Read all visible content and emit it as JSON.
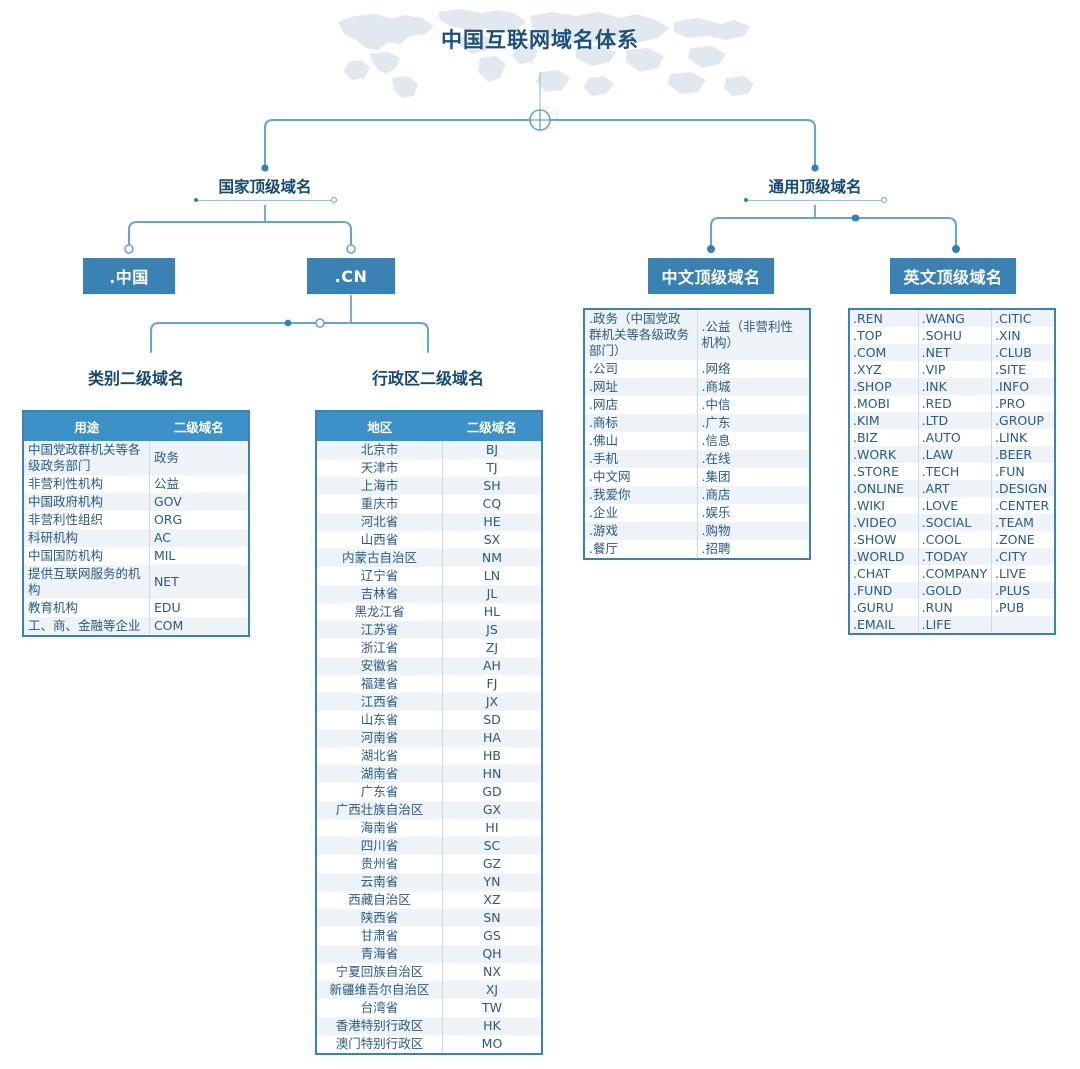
{
  "title": "中国互联网域名体系",
  "nodes": {
    "country_tld": "国家顶级域名",
    "generic_tld": "通用顶级域名"
  },
  "boxes": {
    "cn_chinese": ".中国",
    "cn_ascii": ".CN",
    "chinese_tld": "中文顶级域名",
    "english_tld": "英文顶级域名"
  },
  "captions": {
    "category_sld": "类别二级域名",
    "region_sld": "行政区二级域名"
  },
  "colors": {
    "box_blue": "#3b82b4",
    "header_blue": "#3b91c8",
    "text_dark_blue": "#16496f",
    "cell_text": "#2a5b80",
    "row_stripe": "#eef3f7",
    "border_blue": "#3b82b4",
    "wire_blue": "#4f8fba"
  },
  "category_table": {
    "headers": [
      "用途",
      "二级域名"
    ],
    "rows": [
      [
        "中国党政群机关等各级政务部门",
        "政务"
      ],
      [
        "非营利性机构",
        "公益"
      ],
      [
        "中国政府机构",
        "GOV"
      ],
      [
        "非营利性组织",
        "ORG"
      ],
      [
        "科研机构",
        "AC"
      ],
      [
        "中国国防机构",
        "MIL"
      ],
      [
        "提供互联网服务的机构",
        "NET"
      ],
      [
        "教育机构",
        "EDU"
      ],
      [
        "工、商、金融等企业",
        "COM"
      ]
    ]
  },
  "region_table": {
    "headers": [
      "地区",
      "二级域名"
    ],
    "rows": [
      [
        "北京市",
        "BJ"
      ],
      [
        "天津市",
        "TJ"
      ],
      [
        "上海市",
        "SH"
      ],
      [
        "重庆市",
        "CQ"
      ],
      [
        "河北省",
        "HE"
      ],
      [
        "山西省",
        "SX"
      ],
      [
        "内蒙古自治区",
        "NM"
      ],
      [
        "辽宁省",
        "LN"
      ],
      [
        "吉林省",
        "JL"
      ],
      [
        "黑龙江省",
        "HL"
      ],
      [
        "江苏省",
        "JS"
      ],
      [
        "浙江省",
        "ZJ"
      ],
      [
        "安徽省",
        "AH"
      ],
      [
        "福建省",
        "FJ"
      ],
      [
        "江西省",
        "JX"
      ],
      [
        "山东省",
        "SD"
      ],
      [
        "河南省",
        "HA"
      ],
      [
        "湖北省",
        "HB"
      ],
      [
        "湖南省",
        "HN"
      ],
      [
        "广东省",
        "GD"
      ],
      [
        "广西壮族自治区",
        "GX"
      ],
      [
        "海南省",
        "HI"
      ],
      [
        "四川省",
        "SC"
      ],
      [
        "贵州省",
        "GZ"
      ],
      [
        "云南省",
        "YN"
      ],
      [
        "西藏自治区",
        "XZ"
      ],
      [
        "陕西省",
        "SN"
      ],
      [
        "甘肃省",
        "GS"
      ],
      [
        "青海省",
        "QH"
      ],
      [
        "宁夏回族自治区",
        "NX"
      ],
      [
        "新疆维吾尔自治区",
        "XJ"
      ],
      [
        "台湾省",
        "TW"
      ],
      [
        "香港特别行政区",
        "HK"
      ],
      [
        "澳门特别行政区",
        "MO"
      ]
    ]
  },
  "chinese_tld_table": {
    "rows": [
      [
        ".政务（中国党政群机关等各级政务部门）",
        ".公益（非营利性机构）"
      ],
      [
        ".公司",
        ".网络"
      ],
      [
        ".网址",
        ".商城"
      ],
      [
        ".网店",
        ".中信"
      ],
      [
        ".商标",
        ".广东"
      ],
      [
        ".佛山",
        ".信息"
      ],
      [
        ".手机",
        ".在线"
      ],
      [
        ".中文网",
        ".集团"
      ],
      [
        ".我爱你",
        ".商店"
      ],
      [
        ".企业",
        ".娱乐"
      ],
      [
        ".游戏",
        ".购物"
      ],
      [
        ".餐厅",
        ".招聘"
      ]
    ]
  },
  "english_tld_table": {
    "rows": [
      [
        ".REN",
        ".WANG",
        ".CITIC"
      ],
      [
        ".TOP",
        ".SOHU",
        ".XIN"
      ],
      [
        ".COM",
        ".NET",
        ".CLUB"
      ],
      [
        ".XYZ",
        ".VIP",
        ".SITE"
      ],
      [
        ".SHOP",
        ".INK",
        ".INFO"
      ],
      [
        ".MOBI",
        ".RED",
        ".PRO"
      ],
      [
        ".KIM",
        ".LTD",
        ".GROUP"
      ],
      [
        ".BIZ",
        ".AUTO",
        ".LINK"
      ],
      [
        ".WORK",
        ".LAW",
        ".BEER"
      ],
      [
        ".STORE",
        ".TECH",
        ".FUN"
      ],
      [
        ".ONLINE",
        ".ART",
        ".DESIGN"
      ],
      [
        ".WIKI",
        ".LOVE",
        ".CENTER"
      ],
      [
        ".VIDEO",
        ".SOCIAL",
        ".TEAM"
      ],
      [
        ".SHOW",
        ".COOL",
        ".ZONE"
      ],
      [
        ".WORLD",
        ".TODAY",
        ".CITY"
      ],
      [
        ".CHAT",
        ".COMPANY",
        ".LIVE"
      ],
      [
        ".FUND",
        ".GOLD",
        ".PLUS"
      ],
      [
        ".GURU",
        ".RUN",
        ".PUB"
      ],
      [
        ".EMAIL",
        ".LIFE",
        ""
      ]
    ]
  }
}
